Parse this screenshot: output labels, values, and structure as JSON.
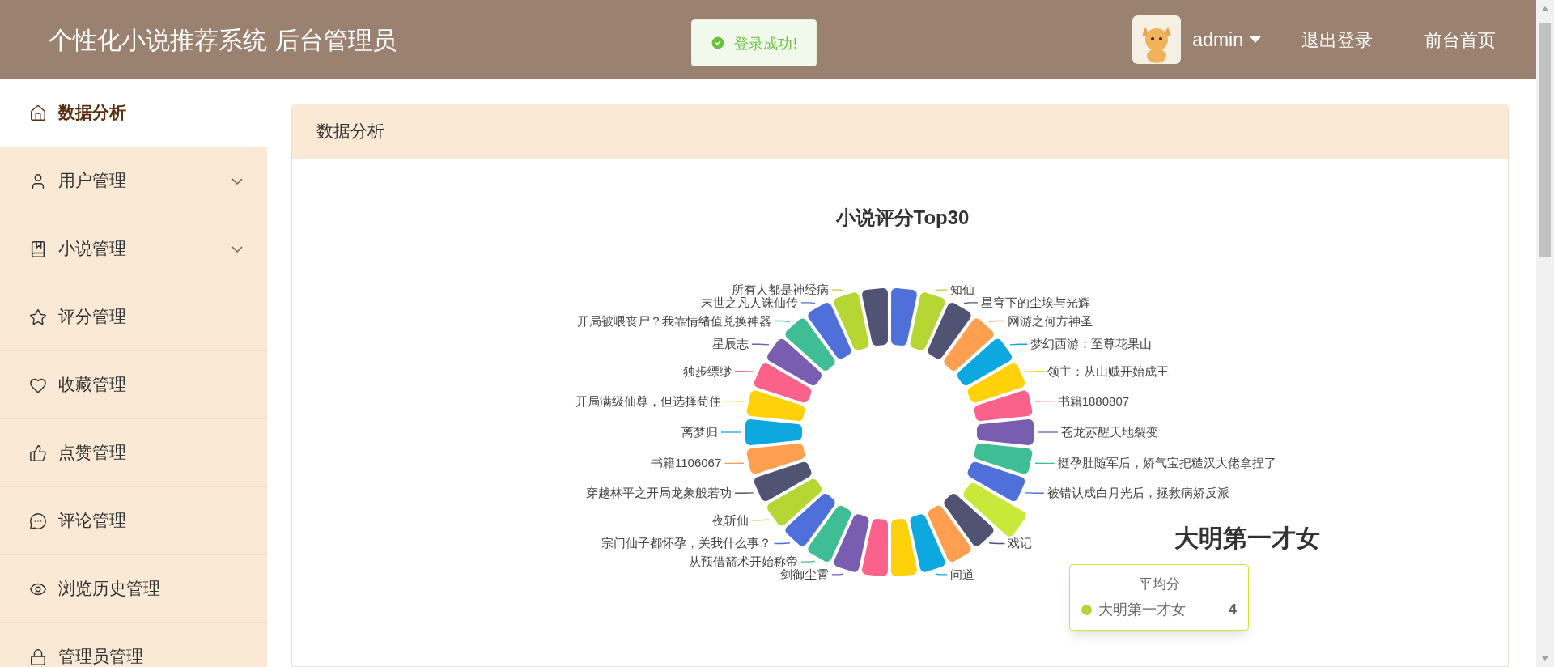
{
  "header": {
    "title": "个性化小说推荐系统 后台管理员",
    "toast": {
      "message": "登录成功!"
    },
    "user": {
      "name": "admin"
    },
    "links": [
      "退出登录",
      "前台首页"
    ]
  },
  "sidebar": {
    "items": [
      {
        "label": "数据分析",
        "selected": true,
        "expandable": false
      },
      {
        "label": "用户管理",
        "selected": false,
        "expandable": true
      },
      {
        "label": "小说管理",
        "selected": false,
        "expandable": true
      },
      {
        "label": "评分管理",
        "selected": false,
        "expandable": false
      },
      {
        "label": "收藏管理",
        "selected": false,
        "expandable": false
      },
      {
        "label": "点赞管理",
        "selected": false,
        "expandable": false
      },
      {
        "label": "评论管理",
        "selected": false,
        "expandable": false
      },
      {
        "label": "浏览历史管理",
        "selected": false,
        "expandable": false
      },
      {
        "label": "管理员管理",
        "selected": false,
        "expandable": false
      }
    ]
  },
  "panel": {
    "title": "数据分析",
    "chart": {
      "title": "小说评分Top30",
      "center_label": "大明第一才女",
      "right_slices": [
        {
          "color": "#505372",
          "highlighted": false
        },
        {
          "color": "#4f6fdb",
          "highlighted": false
        },
        {
          "label": "知仙",
          "color": "#b6d634",
          "highlighted": false
        },
        {
          "label": "星穹下的尘埃与光辉",
          "color": "#505372",
          "highlighted": false
        },
        {
          "label": "网游之何方神圣",
          "color": "#ff9f4f",
          "highlighted": false
        },
        {
          "label": "梦幻西游：至尊花果山",
          "color": "#0ca8df",
          "highlighted": false
        },
        {
          "label": "领主：从山贼开始成王",
          "color": "#ffd10a",
          "highlighted": false
        },
        {
          "label": "书籍1880807",
          "color": "#fb628b",
          "highlighted": false
        },
        {
          "label": "苍龙苏醒天地裂变",
          "color": "#785db0",
          "highlighted": false
        },
        {
          "label": "挺孕肚随军后，娇气宝把糙汉大佬拿捏了",
          "color": "#3fbe95",
          "highlighted": false
        },
        {
          "label": "被错认成白月光后，拯救病娇反派",
          "color": "#4f6fdb",
          "highlighted": false
        },
        {
          "color": "#c8e83a",
          "highlighted": true
        },
        {
          "label": "戏记",
          "color": "#505372",
          "highlighted": false
        },
        {
          "color": "#ff9f4f",
          "highlighted": false
        },
        {
          "label": "问道",
          "color": "#0ca8df",
          "highlighted": false
        }
      ],
      "left_slices": [
        {
          "label": "所有人都是神经病",
          "color": "#b6d634",
          "highlighted": false
        },
        {
          "label": "末世之凡人诛仙传",
          "color": "#4f6fdb",
          "highlighted": false
        },
        {
          "label": "开局被喂丧尸？我靠情绪值兑换神器",
          "color": "#3fbe95",
          "highlighted": false
        },
        {
          "label": "星辰志",
          "color": "#785db0",
          "highlighted": false
        },
        {
          "label": "独步缥缈",
          "color": "#fb628b",
          "highlighted": false
        },
        {
          "label": "开局满级仙尊，但选择苟住",
          "color": "#ffd10a",
          "highlighted": false
        },
        {
          "label": "离梦归",
          "color": "#0ca8df",
          "highlighted": false
        },
        {
          "label": "书籍1106067",
          "color": "#ff9f4f",
          "highlighted": false
        },
        {
          "label": "穿越林平之开局龙象般若功",
          "color": "#505372",
          "highlighted": false
        },
        {
          "label": "夜斩仙",
          "color": "#b6d634",
          "highlighted": false
        },
        {
          "label": "宗门仙子都怀孕，关我什么事？",
          "color": "#4f6fdb",
          "highlighted": false
        },
        {
          "label": "从预借箭术开始称帝",
          "color": "#3fbe95",
          "highlighted": false
        },
        {
          "label": "剑御尘霄",
          "color": "#785db0",
          "highlighted": false
        },
        {
          "color": "#fb628b",
          "highlighted": false
        },
        {
          "color": "#ffd10a",
          "highlighted": false
        }
      ],
      "tooltip": {
        "title": "平均分",
        "name": "大明第一才女",
        "value": "4",
        "color": "#b6d634"
      }
    }
  }
}
